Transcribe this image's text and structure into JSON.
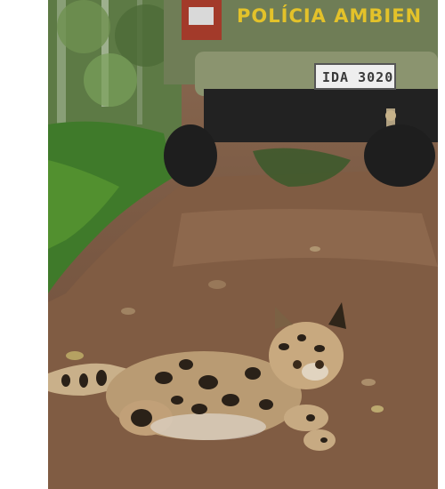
{
  "photo": {
    "truck_lettering": "POLÍCIA AMBIEN",
    "plate_text": "IDA 3020"
  }
}
